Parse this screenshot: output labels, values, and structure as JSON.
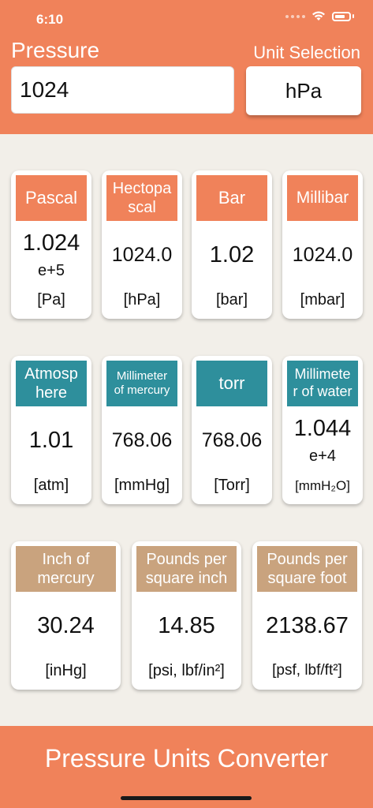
{
  "status": {
    "time": "6:10"
  },
  "header": {
    "pressure_label": "Pressure",
    "unit_selection_label": "Unit Selection",
    "input_value": "1024",
    "selected_unit": "hPa"
  },
  "colors": {
    "accent": "#f0825a",
    "teal": "#2e8f9c",
    "tan": "#c9a37e",
    "background": "#f2efe9"
  },
  "cards": [
    {
      "name": "Pascal",
      "value": "1.024",
      "exponent": "e+5",
      "unit": "[Pa]"
    },
    {
      "name": "Hectopa\nscal",
      "value": "1024.0",
      "unit": "[hPa]"
    },
    {
      "name": "Bar",
      "value": "1.02",
      "unit": "[bar]"
    },
    {
      "name": "Millibar",
      "value": "1024.0",
      "unit": "[mbar]"
    },
    {
      "name": "Atmosp\nhere",
      "value": "1.01",
      "unit": "[atm]"
    },
    {
      "name": "Millimeter\nof mercury",
      "value": "768.06",
      "unit": "[mmHg]"
    },
    {
      "name": "torr",
      "value": "768.06",
      "unit": "[Torr]"
    },
    {
      "name": "Millimete\nr of water",
      "value": "1.044",
      "exponent": "e+4",
      "unit": "[mmH₂O]"
    },
    {
      "name": "Inch of\nmercury",
      "value": "30.24",
      "unit": "[inHg]"
    },
    {
      "name": "Pounds per\nsquare inch",
      "value": "14.85",
      "unit": "[psi, lbf/in²]"
    },
    {
      "name": "Pounds per\nsquare foot",
      "value": "2138.67",
      "unit": "[psf, lbf/ft²]"
    }
  ],
  "footer": {
    "title": "Pressure Units Converter"
  }
}
